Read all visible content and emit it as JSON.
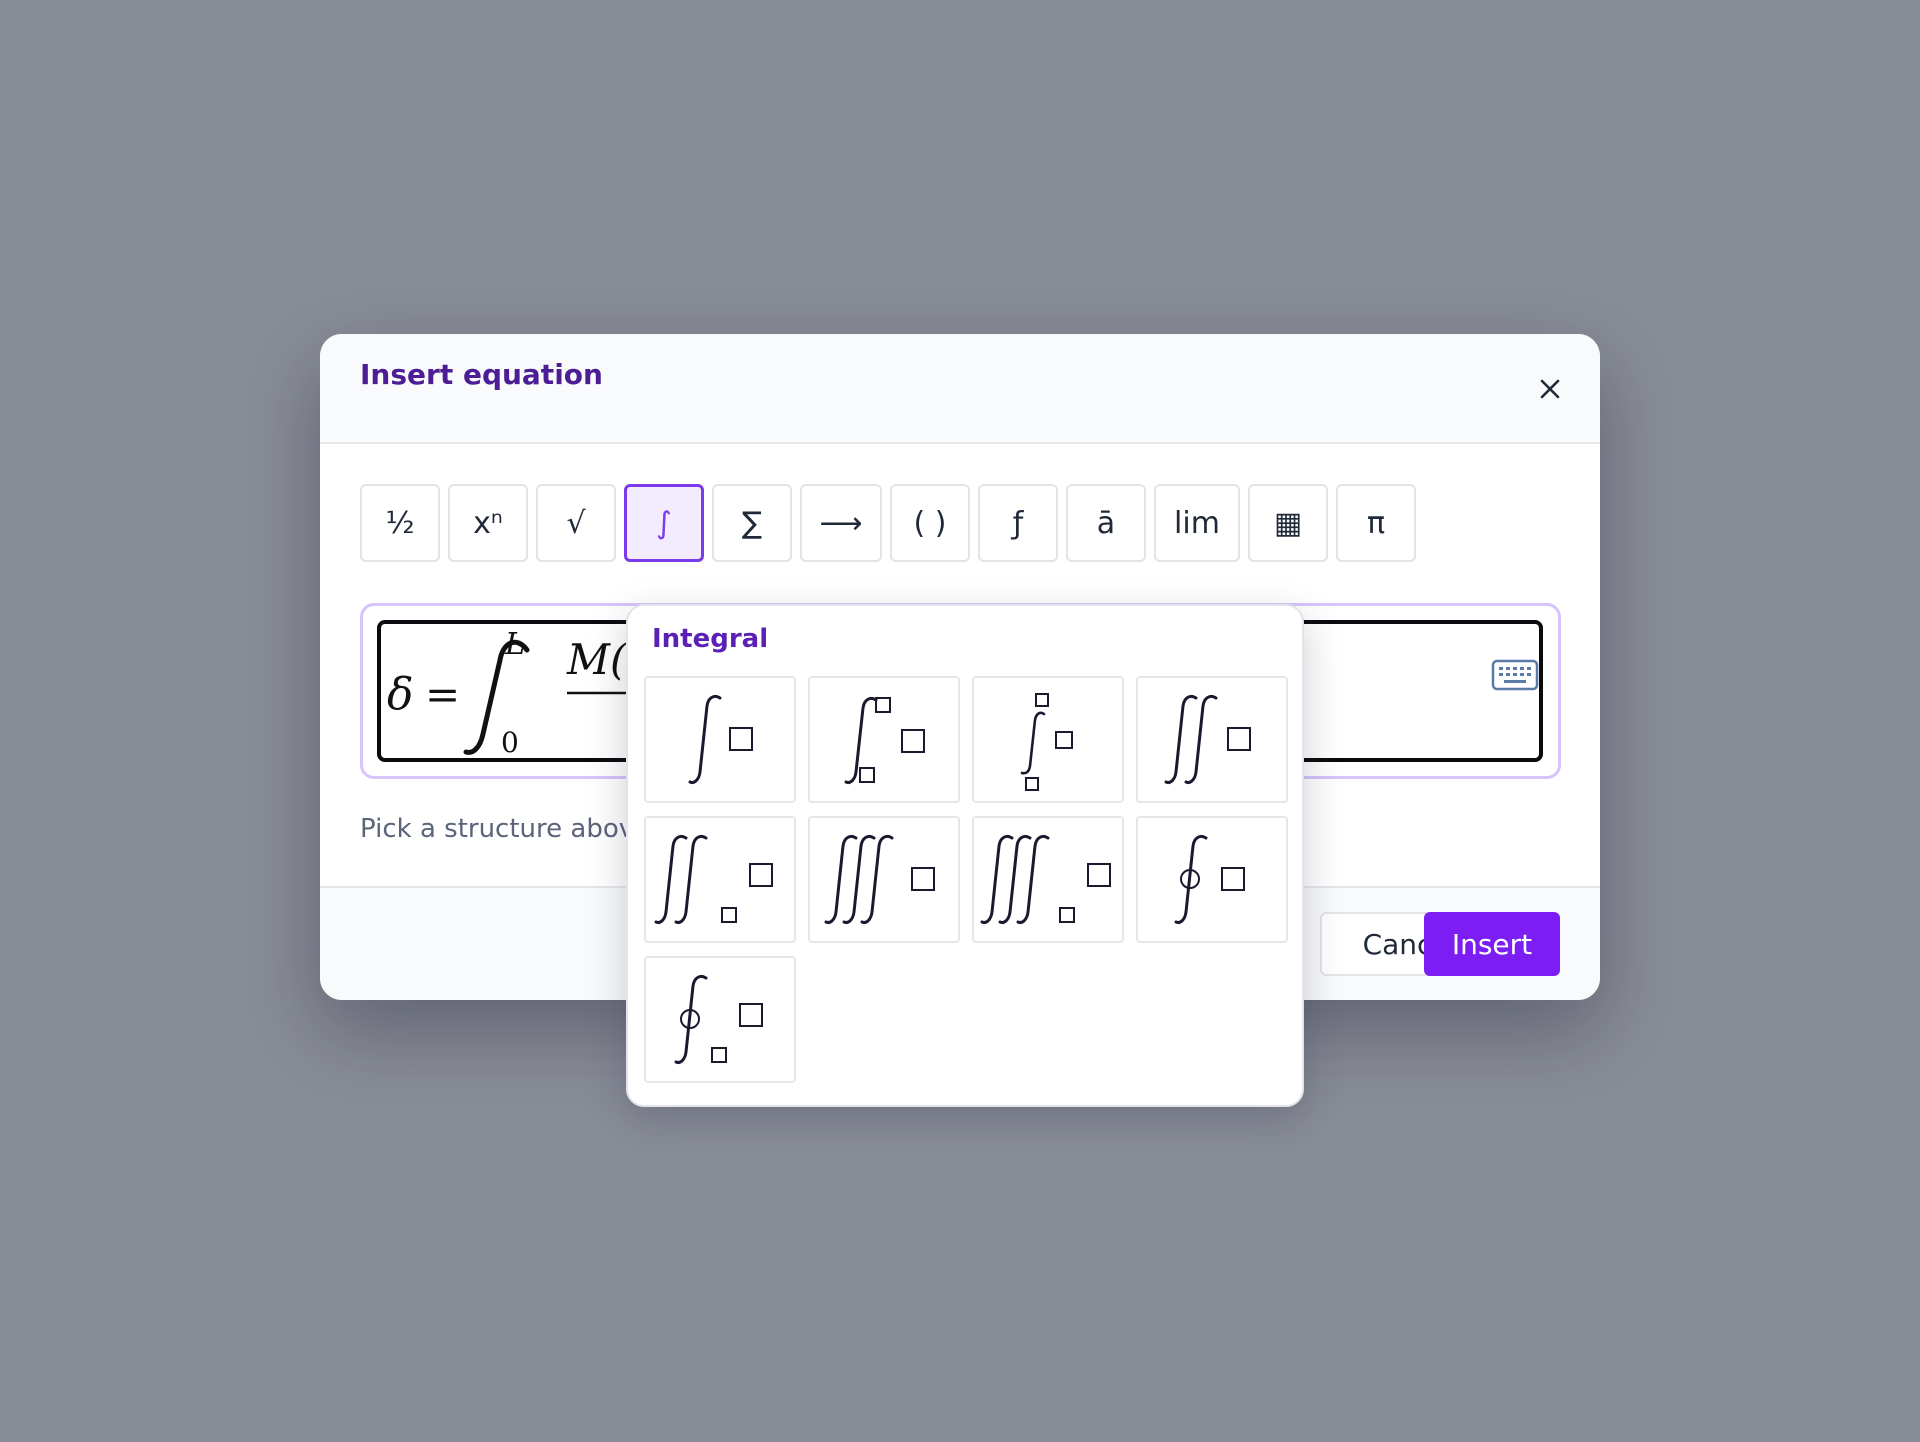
{
  "dialog": {
    "title": "Insert equation",
    "hint": "Pick a structure above, or type LaTeX directly."
  },
  "toolbar": {
    "buttons": [
      {
        "label": "½",
        "name": "fraction"
      },
      {
        "label": "xⁿ",
        "name": "script"
      },
      {
        "label": "√",
        "name": "radical"
      },
      {
        "label": "∫",
        "name": "integral",
        "active": true
      },
      {
        "label": "∑",
        "name": "large-operator"
      },
      {
        "label": "⟶",
        "name": "arrow"
      },
      {
        "label": "( )",
        "name": "bracket"
      },
      {
        "label": "ƒ",
        "name": "function"
      },
      {
        "label": "ā",
        "name": "accent"
      },
      {
        "label": "lim",
        "name": "limit"
      },
      {
        "label": "▦",
        "name": "matrix"
      },
      {
        "label": "π",
        "name": "symbols"
      }
    ]
  },
  "editor": {
    "lhs": "δ",
    "equals": "=",
    "lower_limit": "0",
    "upper_limit": "L",
    "numerator_start": "M("
  },
  "popover": {
    "title": "Integral",
    "items": [
      "integral",
      "integral-with-limits",
      "integral-with-stacked-limits",
      "double-integral",
      "double-integral-with-lower-limit",
      "triple-integral",
      "triple-integral-with-lower-limit",
      "contour-integral",
      "contour-integral-with-lower-limit"
    ]
  },
  "footer": {
    "cancel_label": "Cancel",
    "insert_label": "Insert"
  },
  "colors": {
    "accent": "#7c1df4",
    "title": "#4c1d95",
    "backdrop": "#898d97"
  }
}
